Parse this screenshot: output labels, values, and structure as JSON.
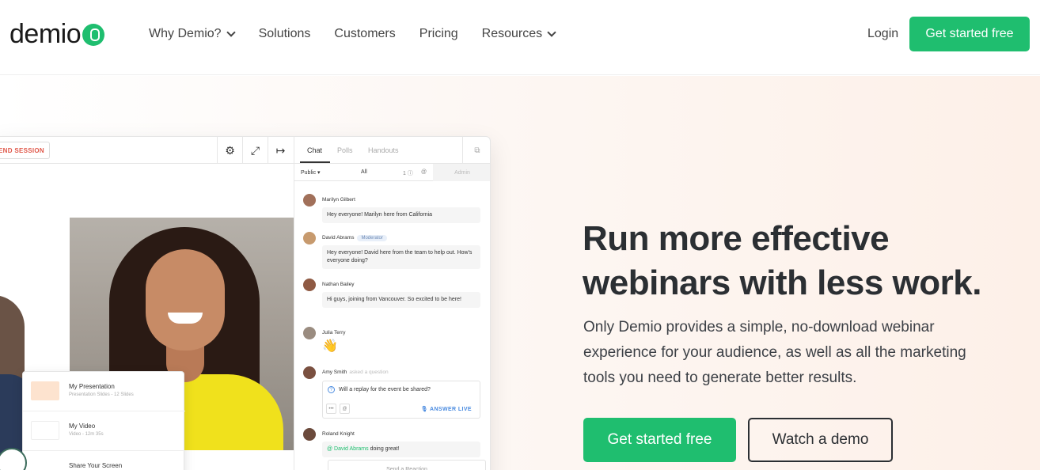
{
  "brand": {
    "name": "demio",
    "accent": "#1fbe6f"
  },
  "nav": {
    "links": [
      {
        "label": "Why Demio?",
        "has_dropdown": true
      },
      {
        "label": "Solutions",
        "has_dropdown": false
      },
      {
        "label": "Customers",
        "has_dropdown": false
      },
      {
        "label": "Pricing",
        "has_dropdown": false
      },
      {
        "label": "Resources",
        "has_dropdown": true
      }
    ],
    "login_label": "Login",
    "cta_label": "Get started free"
  },
  "mock": {
    "end_session_label": "END SESSION",
    "tool_icons": [
      "gear-icon",
      "expand-icon",
      "exit-icon"
    ],
    "content_items": [
      {
        "title": "My Presentation",
        "subtitle": "Presentation Slides - 12 Slides"
      },
      {
        "title": "My Video",
        "subtitle": "Video - 12m 35s"
      },
      {
        "title": "Share Your Screen",
        "subtitle": ""
      }
    ],
    "chat": {
      "tabs": [
        "Chat",
        "Polls",
        "Handouts"
      ],
      "filter_public": "Public",
      "filter_all": "All",
      "question_count": "1",
      "admin_label": "Admin",
      "messages": [
        {
          "name": "Marilyn Gilbert",
          "text": "Hey everyone! Marilyn here from California"
        },
        {
          "name": "David Abrams",
          "role": "Moderator",
          "text": "Hey everyone! David here from the team to help out. How's everyone doing?"
        },
        {
          "name": "Nathan Bailey",
          "text": "Hi guys, joining from Vancouver. So excited to be here!"
        },
        {
          "name": "Julia Terry",
          "text": "👋"
        },
        {
          "name": "Amy Smith",
          "note": "asked a question",
          "text": "Will a replay for the event be shared?",
          "action": "ANSWER LIVE"
        },
        {
          "name": "Roland Knight",
          "mention": "@ David Abrams",
          "text": "doing great!"
        }
      ],
      "input_placeholder": "Send a Reaction"
    }
  },
  "hero": {
    "headline": "Run more effective webinars with less work.",
    "subcopy": "Only Demio provides a simple, no-download webinar experience for your audience, as well as all the marketing tools you need to generate better results.",
    "cta_primary": "Get started free",
    "cta_secondary": "Watch a demo"
  }
}
